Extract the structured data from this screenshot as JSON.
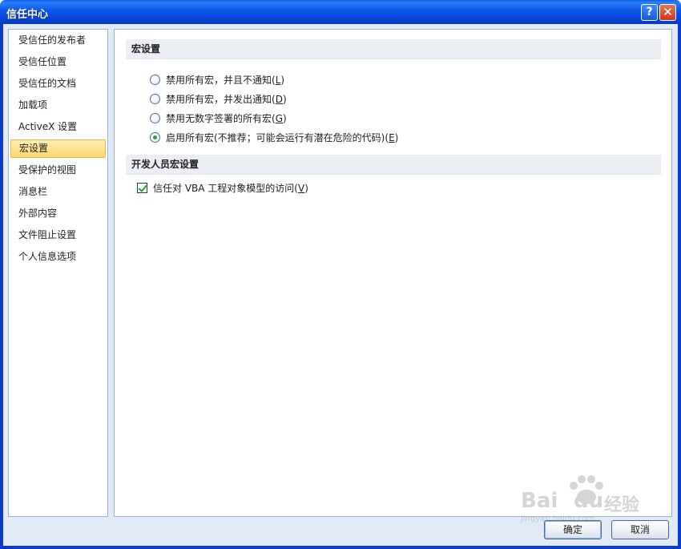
{
  "window": {
    "title": "信任中心",
    "help_glyph": "?",
    "close_glyph": "✕"
  },
  "sidebar": {
    "items": [
      {
        "label": "受信任的发布者",
        "active": false
      },
      {
        "label": "受信任位置",
        "active": false
      },
      {
        "label": "受信任的文档",
        "active": false
      },
      {
        "label": "加载项",
        "active": false
      },
      {
        "label": "ActiveX 设置",
        "active": false
      },
      {
        "label": "宏设置",
        "active": true
      },
      {
        "label": "受保护的视图",
        "active": false
      },
      {
        "label": "消息栏",
        "active": false
      },
      {
        "label": "外部内容",
        "active": false
      },
      {
        "label": "文件阻止设置",
        "active": false
      },
      {
        "label": "个人信息选项",
        "active": false
      }
    ]
  },
  "macro_settings": {
    "heading": "宏设置",
    "options": [
      {
        "text": "禁用所有宏，并且不通知(",
        "key": "L",
        "tail": ")",
        "checked": false
      },
      {
        "text": "禁用所有宏，并发出通知(",
        "key": "D",
        "tail": ")",
        "checked": false
      },
      {
        "text": "禁用无数字签署的所有宏(",
        "key": "G",
        "tail": ")",
        "checked": false
      },
      {
        "text": "启用所有宏(不推荐；可能会运行有潜在危险的代码)(",
        "key": "E",
        "tail": ")",
        "checked": true
      }
    ]
  },
  "developer_settings": {
    "heading": "开发人员宏设置",
    "vba_access": {
      "text": "信任对 VBA 工程对象模型的访问(",
      "key": "V",
      "tail": ")",
      "checked": true
    }
  },
  "buttons": {
    "ok": "确定",
    "cancel": "取消"
  },
  "watermark": {
    "brand": "Bai",
    "brand2": "du",
    "suffix": "经验",
    "url": "jingyan.baidu.com"
  },
  "colors": {
    "titlebar": "#0a5ff1",
    "client_bg": "#e1ebf7",
    "active_item": "#ffd86b",
    "check_green": "#21a121"
  }
}
